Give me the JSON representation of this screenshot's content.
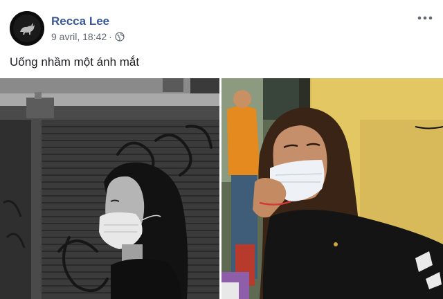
{
  "post": {
    "author": "Recca Lee",
    "date": "9 avril, 18:42",
    "separator": "·",
    "caption": "Uống nhầm một ánh mắt",
    "privacy_icon": "globe-icon",
    "more_icon": "more-options-icon"
  },
  "photos": [
    {
      "name": "photo-left",
      "tone": "grayscale",
      "subject": "woman-with-mask-street"
    },
    {
      "name": "photo-right",
      "tone": "color",
      "subject": "woman-with-mask-yellow-wall"
    }
  ],
  "colors": {
    "author_link": "#385898",
    "meta_text": "#616770",
    "body_text": "#1c1e21",
    "background": "#ffffff"
  }
}
